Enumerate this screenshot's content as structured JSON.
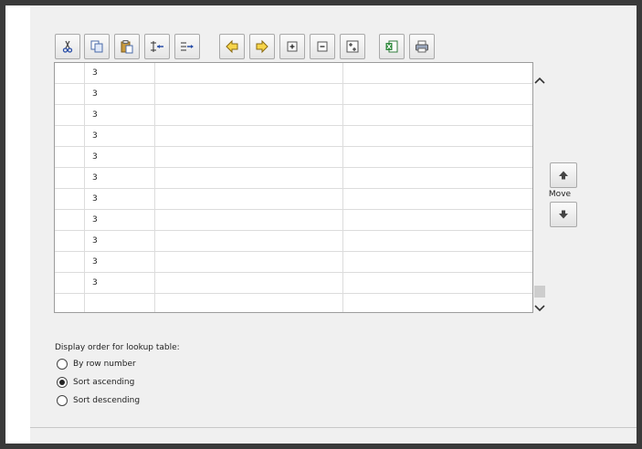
{
  "toolbar": {
    "buttons": [
      {
        "icon": "scissors-icon",
        "action": "cut"
      },
      {
        "icon": "copy-icon",
        "action": "copy"
      },
      {
        "icon": "paste-icon",
        "action": "paste"
      },
      {
        "icon": "insert-row-before-icon",
        "action": "insert-before"
      },
      {
        "icon": "insert-row-after-icon",
        "action": "insert-after"
      },
      {
        "icon": "arrow-left-icon",
        "action": "move-left"
      },
      {
        "icon": "arrow-right-icon",
        "action": "move-right"
      },
      {
        "icon": "expand-icon",
        "action": "expand"
      },
      {
        "icon": "collapse-icon",
        "action": "collapse"
      },
      {
        "icon": "expand-all-icon",
        "action": "expand-all"
      },
      {
        "icon": "excel-icon",
        "action": "export-excel"
      },
      {
        "icon": "print-icon",
        "action": "print"
      }
    ]
  },
  "grid": {
    "rows": [
      {
        "col0": "",
        "col1": "3",
        "col2": "",
        "col3": ""
      },
      {
        "col0": "",
        "col1": "3",
        "col2": "",
        "col3": ""
      },
      {
        "col0": "",
        "col1": "3",
        "col2": "",
        "col3": ""
      },
      {
        "col0": "",
        "col1": "3",
        "col2": "",
        "col3": ""
      },
      {
        "col0": "",
        "col1": "3",
        "col2": "",
        "col3": ""
      },
      {
        "col0": "",
        "col1": "3",
        "col2": "",
        "col3": ""
      },
      {
        "col0": "",
        "col1": "3",
        "col2": "",
        "col3": ""
      },
      {
        "col0": "",
        "col1": "3",
        "col2": "",
        "col3": ""
      },
      {
        "col0": "",
        "col1": "3",
        "col2": "",
        "col3": ""
      },
      {
        "col0": "",
        "col1": "3",
        "col2": "",
        "col3": ""
      },
      {
        "col0": "",
        "col1": "3",
        "col2": "",
        "col3": ""
      },
      {
        "col0": "",
        "col1": "",
        "col2": "",
        "col3": ""
      }
    ]
  },
  "move": {
    "label": "Move"
  },
  "display_order": {
    "label": "Display order for lookup table:",
    "options": [
      {
        "label": "By row number",
        "checked": false
      },
      {
        "label": "Sort ascending",
        "checked": true
      },
      {
        "label": "Sort descending",
        "checked": false
      }
    ]
  },
  "colors": {
    "background": "#f0f0f0",
    "grid_border": "#9c9c9c",
    "grid_line": "#dcdcdc",
    "frame": "#3a3a3a"
  }
}
